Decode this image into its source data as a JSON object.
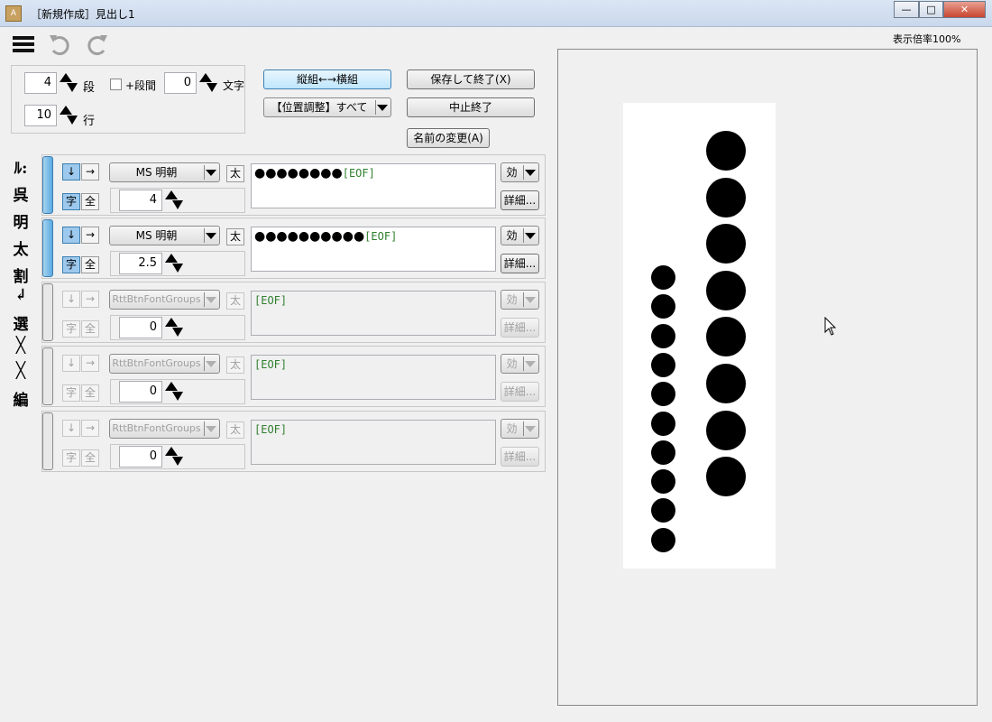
{
  "window": {
    "title": "［新規作成］見出し1",
    "app_icon_text": "A",
    "minimize": "—",
    "maximize": "□",
    "close": "✕"
  },
  "toolbar": {
    "menu_icon": "hamburger-icon",
    "undo_icon": "undo-icon",
    "redo_icon": "redo-icon",
    "zoom_label": "表示倍率100%"
  },
  "layout": {
    "columns_value": "4",
    "columns_label": "段",
    "gap_checkbox_label": "+段間",
    "chars_value": "0",
    "chars_label": "文字",
    "lines_value": "10",
    "lines_label": "行"
  },
  "actions": {
    "orientation": "縦組←→横組",
    "position_adjust": "【位置調整】すべて",
    "save_exit": "保存して終了(X)",
    "cancel_exit": "中止終了",
    "rename": "名前の変更(A)"
  },
  "sidebar": [
    "ﾙ:",
    "呉",
    "明",
    "太",
    "割",
    "↲",
    "選",
    "╳",
    "╳",
    "編"
  ],
  "rows": [
    {
      "dir_down": "↓",
      "dir_right": "→",
      "font": "MS 明朝",
      "bold": "太",
      "char": "字",
      "all": "全",
      "size": "4",
      "text": "●●●●●●●●",
      "eof": "[EOF]",
      "effect": "効",
      "detail": "詳細...",
      "enabled": true
    },
    {
      "dir_down": "↓",
      "dir_right": "→",
      "font": "MS 明朝",
      "bold": "太",
      "char": "字",
      "all": "全",
      "size": "2.5",
      "text": "●●●●●●●●●●",
      "eof": "[EOF]",
      "effect": "効",
      "detail": "詳細...",
      "enabled": true
    },
    {
      "dir_down": "↓",
      "dir_right": "→",
      "font": "RttBtnFontGroups",
      "bold": "太",
      "char": "字",
      "all": "全",
      "size": "0",
      "text": "",
      "eof": "[EOF]",
      "effect": "効",
      "detail": "詳細...",
      "enabled": false
    },
    {
      "dir_down": "↓",
      "dir_right": "→",
      "font": "RttBtnFontGroups",
      "bold": "太",
      "char": "字",
      "all": "全",
      "size": "0",
      "text": "",
      "eof": "[EOF]",
      "effect": "効",
      "detail": "詳細...",
      "enabled": false
    },
    {
      "dir_down": "↓",
      "dir_right": "→",
      "font": "RttBtnFontGroups",
      "bold": "太",
      "char": "字",
      "all": "全",
      "size": "0",
      "text": "",
      "eof": "[EOF]",
      "effect": "効",
      "detail": "詳細...",
      "enabled": false
    }
  ],
  "preview": {
    "column_1_dots": 8,
    "column_2_dots": 10
  }
}
